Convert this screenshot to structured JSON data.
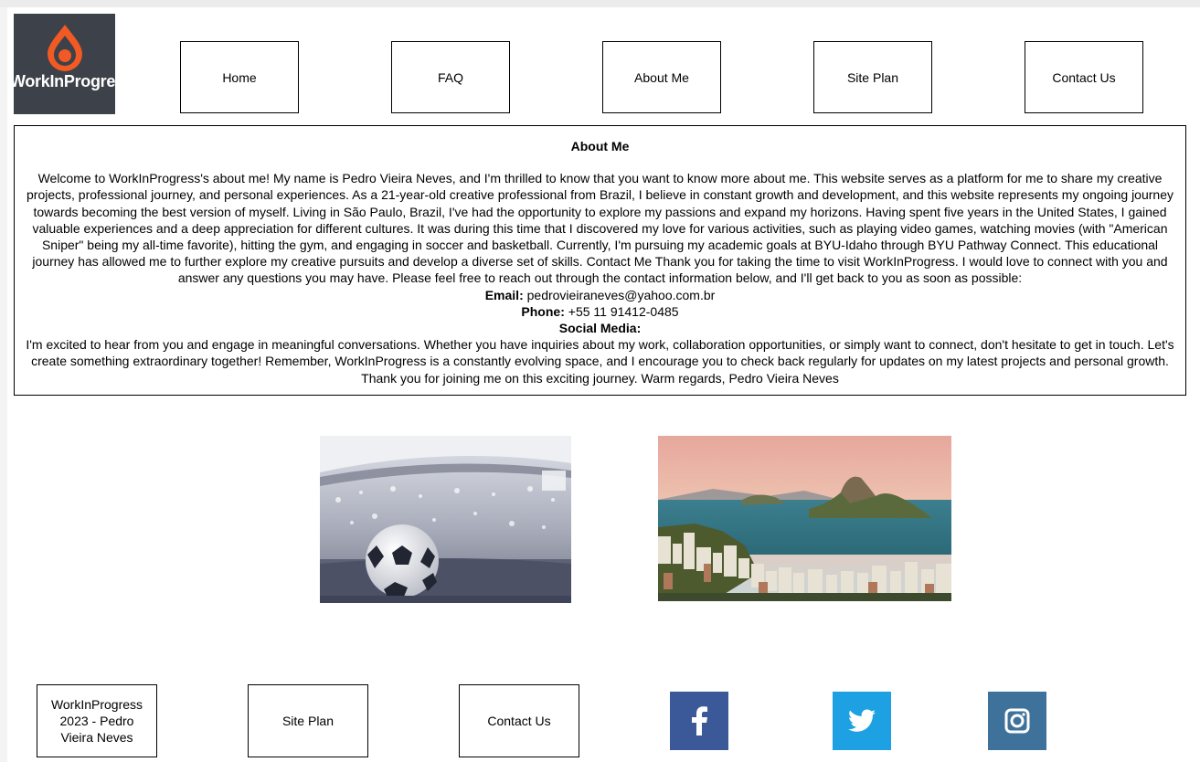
{
  "logo": {
    "text": "WorkInProgress"
  },
  "nav": [
    {
      "label": "Home"
    },
    {
      "label": "FAQ"
    },
    {
      "label": "About Me"
    },
    {
      "label": "Site Plan"
    },
    {
      "label": "Contact Us"
    }
  ],
  "about": {
    "heading": "About Me",
    "intro": "Welcome to WorkInProgress's about me! My name is Pedro Vieira Neves, and I'm thrilled to know that you want to know more about me. This website serves as a platform for me to share my creative projects, professional journey, and personal experiences. As a 21-year-old creative professional from Brazil, I believe in constant growth and development, and this website represents my ongoing journey towards becoming the best version of myself. Living in São Paulo, Brazil, I've had the opportunity to explore my passions and expand my horizons. Having spent five years in the United States, I gained valuable experiences and a deep appreciation for different cultures. It was during this time that I discovered my love for various activities, such as playing video games, watching movies (with \"American Sniper\" being my all-time favorite), hitting the gym, and engaging in soccer and basketball. Currently, I'm pursuing my academic goals at BYU-Idaho through BYU Pathway Connect. This educational journey has allowed me to further explore my creative pursuits and develop a diverse set of skills. Contact Me Thank you for taking the time to visit WorkInProgress. I would love to connect with you and answer any questions you may have. Please feel free to reach out through the contact information below, and I'll get back to you as soon as possible:",
    "email_label": "Email:",
    "email_value": "pedrovieiraneves@yahoo.com.br",
    "phone_label": "Phone:",
    "phone_value": "+55 11 91412-0485",
    "social_label": "Social Media:",
    "closing": "I'm excited to hear from you and engage in meaningful conversations. Whether you have inquiries about my work, collaboration opportunities, or simply want to connect, don't hesitate to get in touch. Let's create something extraordinary together! Remember, WorkInProgress is a constantly evolving space, and I encourage you to check back regularly for updates on my latest projects and personal growth. Thank you for joining me on this exciting journey. Warm regards, Pedro Vieira Neves"
  },
  "images": [
    {
      "name": "soccer-ball-stadium-image"
    },
    {
      "name": "rio-de-janeiro-sugarloaf-image"
    }
  ],
  "footer": {
    "copyright": "WorkInProgress 2023 - Pedro Vieira Neves",
    "site_plan": "Site Plan",
    "contact": "Contact Us",
    "social": [
      {
        "icon": "facebook-icon",
        "color": "#3b5998"
      },
      {
        "icon": "twitter-icon",
        "color": "#1da1e2"
      },
      {
        "icon": "instagram-icon",
        "color": "#3f729b"
      }
    ]
  }
}
